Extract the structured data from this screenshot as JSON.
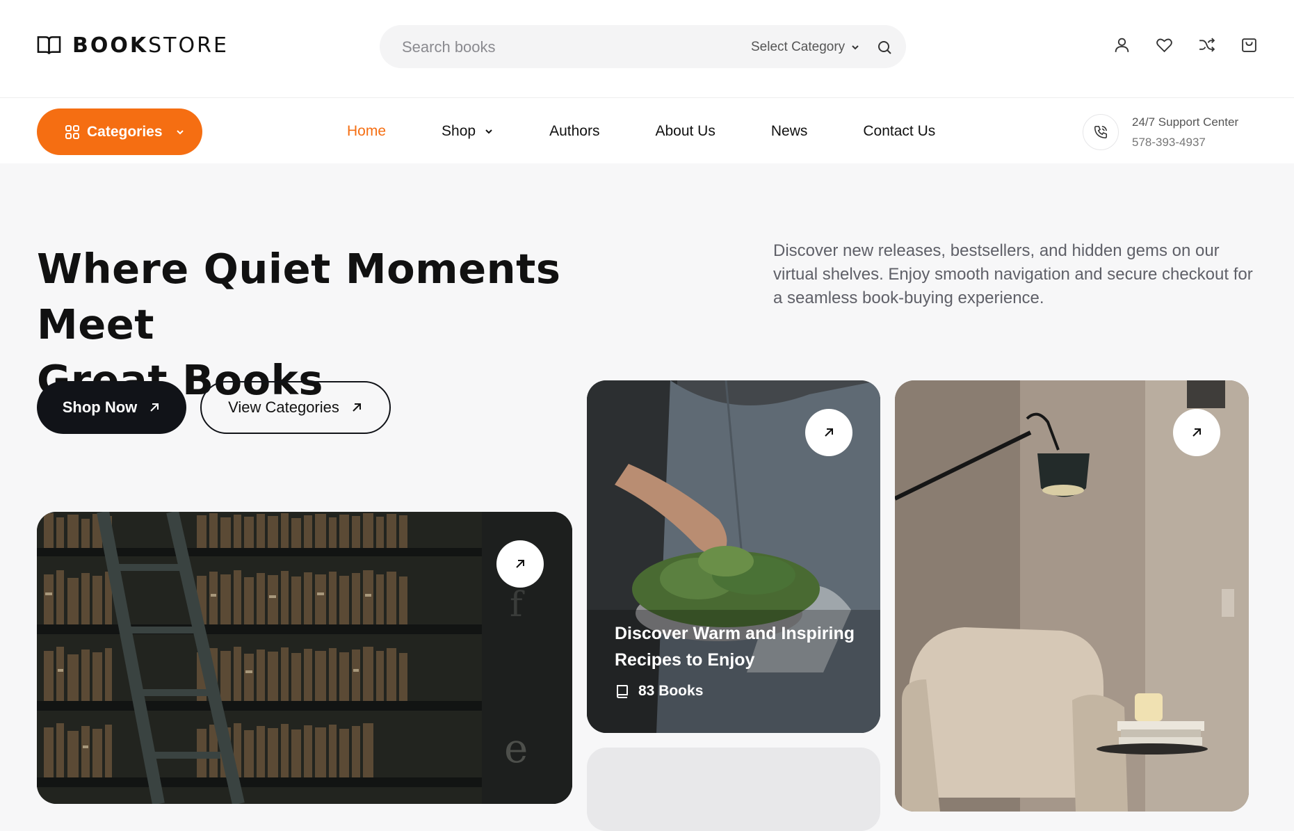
{
  "header": {
    "logo": {
      "icon": "book-open-icon",
      "bold": "BOOK",
      "light": "STORE"
    },
    "search": {
      "placeholder": "Search books",
      "category_label": "Select Category",
      "icon": "search-icon"
    },
    "icons": [
      "user-icon",
      "heart-icon",
      "shuffle-icon",
      "cart-icon"
    ]
  },
  "nav": {
    "categories_button": "Categories",
    "links": [
      {
        "label": "Home",
        "active": true
      },
      {
        "label": "Shop",
        "dropdown": true
      },
      {
        "label": "Authors"
      },
      {
        "label": "About Us"
      },
      {
        "label": "News"
      },
      {
        "label": "Contact Us"
      }
    ],
    "support": {
      "title": "24/7 Support Center",
      "phone": "578-393-4937",
      "icon": "phone-icon"
    }
  },
  "hero": {
    "title_line1": "Where Quiet Moments Meet",
    "title_line2": "Great Books",
    "description": "Discover new releases, bestsellers, and hidden gems on our virtual shelves. Enjoy smooth navigation and secure checkout for a seamless book-buying experience.",
    "primary_button": "Shop Now",
    "secondary_button": "View Categories"
  },
  "cards": {
    "recipes": {
      "title": "Discover Warm and Inspiring Recipes to Enjoy",
      "count": "83 Books"
    }
  },
  "colors": {
    "accent": "#f56e12",
    "dark": "#111318",
    "background": "#f7f7f8"
  }
}
